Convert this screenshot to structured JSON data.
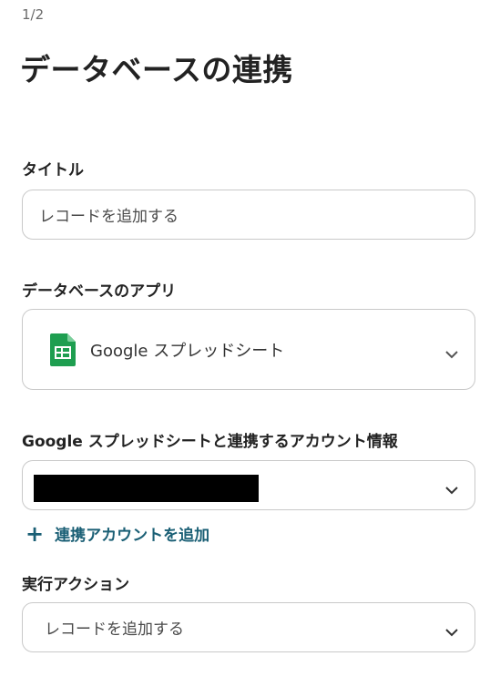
{
  "step": {
    "indicator": "1/2"
  },
  "page": {
    "title": "データベースの連携"
  },
  "title_field": {
    "label": "タイトル",
    "value": "レコードを追加する"
  },
  "app_field": {
    "label": "データベースのアプリ",
    "selected_app": "Google スプレッドシート",
    "icon": "google-sheets-icon",
    "icon_color": "#188038"
  },
  "account_field": {
    "label": "Google スプレッドシートと連携するアカウント情報",
    "value_redacted": true,
    "add_account_label": "連携アカウントを追加",
    "link_color": "#1a5f75"
  },
  "action_field": {
    "label": "実行アクション",
    "selected_action": "レコードを追加する"
  }
}
